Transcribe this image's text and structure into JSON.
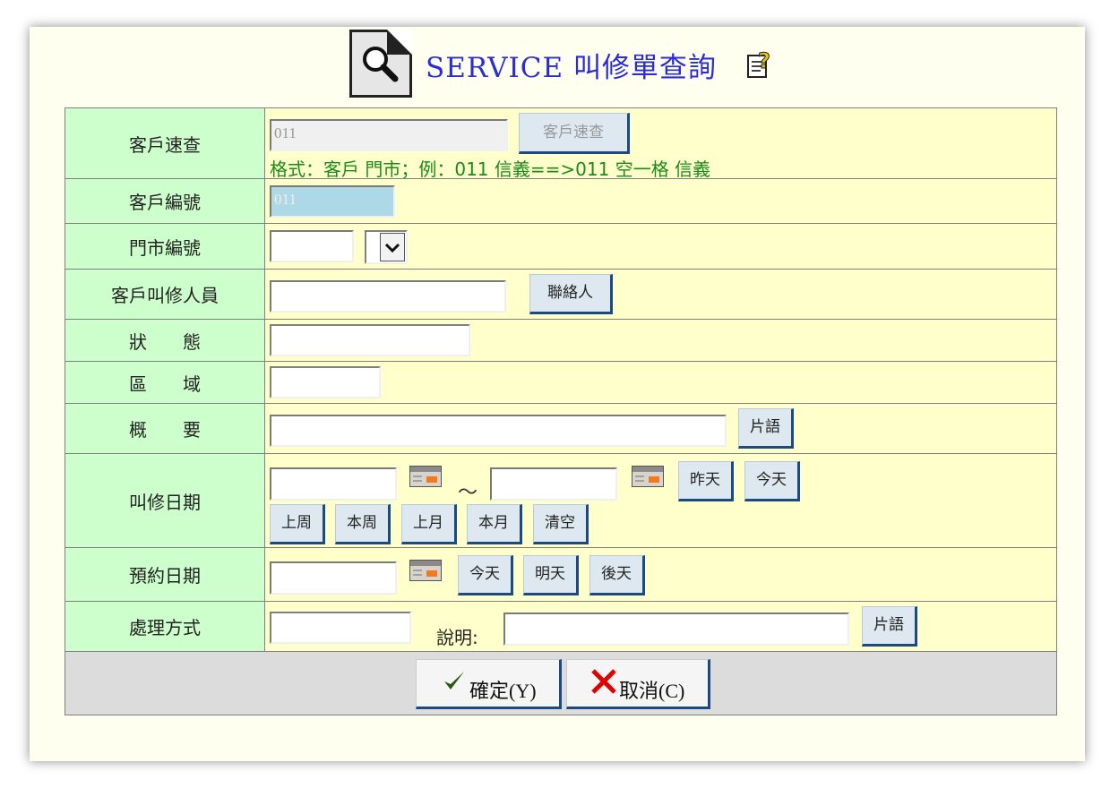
{
  "header": {
    "title": "SERVICE 叫修單查詢"
  },
  "rows": {
    "quick": {
      "label": "客戶速查",
      "value": "011",
      "button": "客戶速查",
      "hint": "格式：客戶 門市；例：011 信義==>011 空一格 信義"
    },
    "customer_no": {
      "label": "客戶編號",
      "value": "011"
    },
    "store_no": {
      "label": "門市編號",
      "value": ""
    },
    "requester": {
      "label": "客戶叫修人員",
      "value": "",
      "button": "聯絡人"
    },
    "status": {
      "label": "狀　　態",
      "value": ""
    },
    "region": {
      "label": "區　　域",
      "value": ""
    },
    "summary": {
      "label": "概　　要",
      "value": "",
      "button": "片語"
    },
    "call_date": {
      "label": "叫修日期",
      "from": "",
      "to": "",
      "separator": "～",
      "buttons": [
        "昨天",
        "今天",
        "上周",
        "本周",
        "上月",
        "本月",
        "清空"
      ]
    },
    "appointment": {
      "label": "預約日期",
      "value": "",
      "buttons": [
        "今天",
        "明天",
        "後天"
      ]
    },
    "handling": {
      "label": "處理方式",
      "value": "",
      "note_label": "說明:",
      "note_value": "",
      "button": "片語"
    }
  },
  "footer": {
    "confirm_label": "確定(Y)",
    "cancel_label": "取消(C)"
  },
  "colors": {
    "label_bg": "#ccffcc",
    "field_bg": "#ffffcc",
    "title": "#2b2bd9",
    "hint": "#1a8a1a",
    "check": "#2a5a10",
    "cross": "#e00000"
  }
}
